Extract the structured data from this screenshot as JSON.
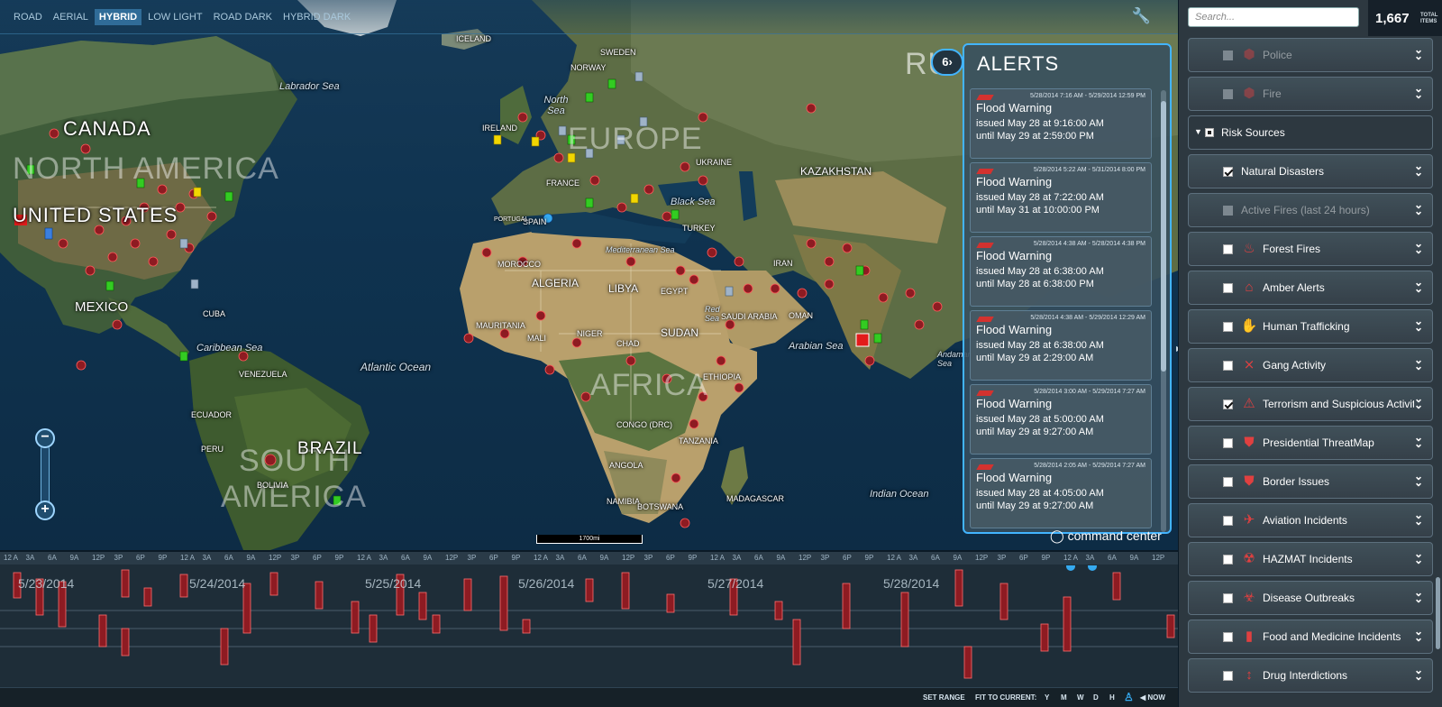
{
  "map_styles": [
    "ROAD",
    "AERIAL",
    "HYBRID",
    "LOW LIGHT",
    "ROAD DARK",
    "HYBRID DARK"
  ],
  "map_styles_active": "HYBRID",
  "map_labels": {
    "canada": "CANADA",
    "north_america": "NORTH AMERICA",
    "united_states": "UNITED STATES",
    "mexico": "MEXICO",
    "south_america_1": "SOUTH",
    "south_america_2": "AMERICA",
    "brazil": "BRAZIL",
    "peru": "PERU",
    "bolivia": "BOLIVIA",
    "venezuela": "VENEZUELA",
    "ecuador": "ECUADOR",
    "cuba": "CUBA",
    "europe": "EUROPE",
    "africa": "AFRICA",
    "algeria": "ALGERIA",
    "libya": "LIBYA",
    "egypt": "EGYPT",
    "sudan": "SUDAN",
    "niger": "NIGER",
    "chad": "CHAD",
    "mali": "MALI",
    "mauritania": "MAURITANIA",
    "morocco": "MOROCCO",
    "ethiopia": "ETHIOPIA",
    "congo": "CONGO (DRC)",
    "tanzania": "TANZANIA",
    "angola": "ANGOLA",
    "namibia": "NAMIBIA",
    "botswana": "BOTSWANA",
    "madagascar": "MADAGASCAR",
    "saudi_arabia": "SAUDI ARABIA",
    "iran": "IRAN",
    "oman": "OMAN",
    "turkey": "TURKEY",
    "kazakhstan": "KAZAKHSTAN",
    "ukraine": "UKRAINE",
    "france": "FRANCE",
    "spain": "SPAIN",
    "portugal": "PORTUGAL",
    "norway": "NORWAY",
    "sweden": "SWEDEN",
    "iceland": "ICELAND",
    "russia": "RU",
    "ireland": "IRELAND",
    "labrador_sea": "Labrador Sea",
    "north_sea": "North Sea",
    "caribbean_sea": "Caribbean Sea",
    "atlantic_ocean": "Atlantic Ocean",
    "mediterranean_sea": "Mediterranean Sea",
    "black_sea": "Black Sea",
    "red_sea": "Red Sea",
    "arabian_sea": "Arabian Sea",
    "indian_ocean": "Indian Ocean",
    "andaman": "Andaman Sea"
  },
  "alerts": {
    "count": "6",
    "title": "ALERTS",
    "items": [
      {
        "date": "5/28/2014 7:16 AM - 5/29/2014 12:59 PM",
        "name": "Flood Warning",
        "issued": "issued May 28 at 9:16:00 AM",
        "until": "until May 29 at 2:59:00 PM"
      },
      {
        "date": "5/28/2014 5:22 AM - 5/31/2014 8:00 PM",
        "name": "Flood Warning",
        "issued": "issued May 28 at 7:22:00 AM",
        "until": "until May 31 at 10:00:00 PM"
      },
      {
        "date": "5/28/2014 4:38 AM - 5/28/2014 4:38 PM",
        "name": "Flood Warning",
        "issued": "issued May 28 at 6:38:00 AM",
        "until": "until May 28 at 6:38:00 PM"
      },
      {
        "date": "5/28/2014 4:38 AM - 5/29/2014 12:29 AM",
        "name": "Flood Warning",
        "issued": "issued May 28 at 6:38:00 AM",
        "until": "until May 29 at 2:29:00 AM"
      },
      {
        "date": "5/28/2014 3:00 AM - 5/29/2014 7:27 AM",
        "name": "Flood Warning",
        "issued": "issued May 28 at 5:00:00 AM",
        "until": "until May 29 at 9:27:00 AM"
      },
      {
        "date": "5/28/2014 2:05 AM - 5/29/2014 7:27 AM",
        "name": "Flood Warning",
        "issued": "issued May 28 at 4:05:00 AM",
        "until": "until May 29 at 9:27:00 AM"
      }
    ]
  },
  "brand": "command center",
  "scale": "1700mi",
  "timeline": {
    "tick_pattern": [
      "12 A",
      "3A",
      "6A",
      "9A",
      "12P",
      "3P",
      "6P",
      "9P"
    ],
    "dates": [
      "5/23/2014",
      "5/24/2014",
      "5/25/2014",
      "5/26/2014",
      "5/27/2014",
      "5/28/2014"
    ],
    "set_range": "SET RANGE",
    "fit_to_current": "FIT TO CURRENT:",
    "y": "Y",
    "m": "M",
    "w": "W",
    "d": "D",
    "h": "H",
    "now": "NOW"
  },
  "panel": {
    "search_placeholder": "Search...",
    "total_count": "1,667",
    "total_label_1": "TOTAL",
    "total_label_2": "ITEMS",
    "layers": [
      {
        "label": "Police",
        "state": "disabled",
        "dim": true,
        "icon": "police-badge-icon"
      },
      {
        "label": "Fire",
        "state": "disabled",
        "dim": true,
        "icon": "fire-badge-icon"
      },
      {
        "label": "Risk Sources",
        "state": "group",
        "dim": false,
        "icon": ""
      },
      {
        "label": "Natural Disasters",
        "state": "checked",
        "dim": false,
        "icon": ""
      },
      {
        "label": "Active Fires (last 24 hours)",
        "state": "disabled",
        "dim": true,
        "icon": ""
      },
      {
        "label": "Forest Fires",
        "state": "unchecked",
        "dim": false,
        "icon": "forest-fire-icon"
      },
      {
        "label": "Amber Alerts",
        "state": "unchecked",
        "dim": false,
        "icon": "amber-alert-icon"
      },
      {
        "label": "Human Trafficking",
        "state": "unchecked",
        "dim": false,
        "icon": "human-trafficking-icon"
      },
      {
        "label": "Gang Activity",
        "state": "unchecked",
        "dim": false,
        "icon": "gun-icon"
      },
      {
        "label": "Terrorism and Suspicious Activity",
        "state": "checked",
        "dim": false,
        "icon": "terrorism-icon"
      },
      {
        "label": "Presidential ThreatMap",
        "state": "unchecked",
        "dim": false,
        "icon": "presidential-shield-icon"
      },
      {
        "label": "Border Issues",
        "state": "unchecked",
        "dim": false,
        "icon": "border-shield-icon"
      },
      {
        "label": "Aviation Incidents",
        "state": "unchecked",
        "dim": false,
        "icon": "airplane-icon"
      },
      {
        "label": "HAZMAT Incidents",
        "state": "unchecked",
        "dim": false,
        "icon": "hazmat-icon"
      },
      {
        "label": "Disease Outbreaks",
        "state": "unchecked",
        "dim": false,
        "icon": "biohazard-icon"
      },
      {
        "label": "Food and Medicine Incidents",
        "state": "unchecked",
        "dim": false,
        "icon": "pill-icon"
      },
      {
        "label": "Drug Interdictions",
        "state": "unchecked",
        "dim": false,
        "icon": "syringe-icon"
      }
    ]
  },
  "colors": {
    "accent": "#42b4ff",
    "marker_red": "#8e1b22",
    "marker_green": "#33cc22",
    "marker_blue": "#5a9ed8",
    "marker_yellow": "#f2d600"
  }
}
